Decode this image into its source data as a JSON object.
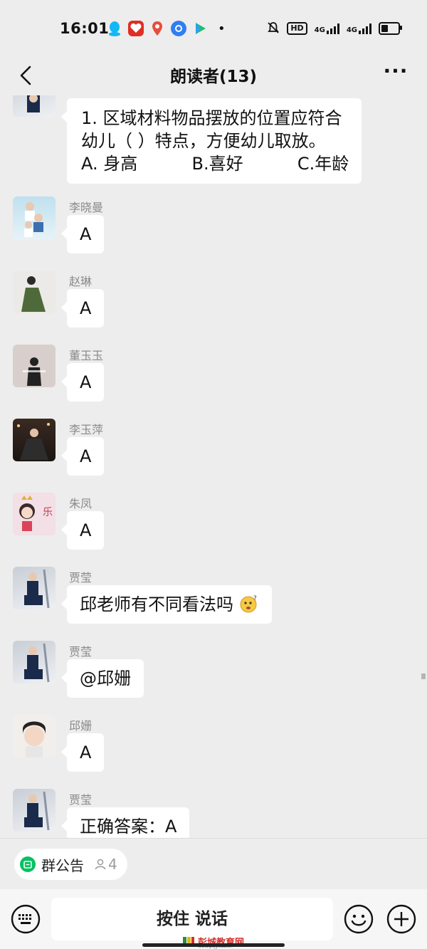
{
  "status_bar": {
    "time": "16:01",
    "dot": "•",
    "hd_label": "HD",
    "net_label_1": "4G",
    "net_label_2": "4G",
    "battery_level_percent": 40
  },
  "header": {
    "back_icon": "chevron-left-icon",
    "title": "朗读者(13)",
    "more_icon": "more-dots-icon",
    "more_label": "···"
  },
  "messages": [
    {
      "sender": "",
      "lines": [
        "1. 区域材料物品摆放的位置应符合",
        "幼儿（   ）特点，方便幼儿取放。",
        "A. 身高          B.喜好          C.年龄"
      ],
      "avatar": "avatar-partial"
    },
    {
      "sender": "李晓曼",
      "text": "A"
    },
    {
      "sender": "赵琳",
      "text": "A"
    },
    {
      "sender": "董玉玉",
      "text": "A"
    },
    {
      "sender": "李玉萍",
      "text": "A"
    },
    {
      "sender": "朱凤",
      "text": "A"
    },
    {
      "sender": "贾莹",
      "text": "邱老师有不同看法吗",
      "emoji": "thinking-face-emoji"
    },
    {
      "sender": "贾莹",
      "text": "@邱姗"
    },
    {
      "sender": "邱姗",
      "text": "A"
    },
    {
      "sender": "贾莹",
      "text": "正确答案：A"
    }
  ],
  "notice": {
    "label": "群公告",
    "count": "4",
    "icon": "notice-icon"
  },
  "input_bar": {
    "voice_label": "按住 说话",
    "keyboard_icon": "keyboard-icon",
    "emoji_icon": "smiley-icon",
    "plus_icon": "plus-icon"
  },
  "watermark": {
    "text": "彭城教育网",
    "sub": "www.pcjyedu.cn"
  },
  "colors": {
    "background": "#ededed",
    "bubble": "#ffffff",
    "accent_green": "#07c160",
    "sender_gray": "#8a8a8a"
  }
}
